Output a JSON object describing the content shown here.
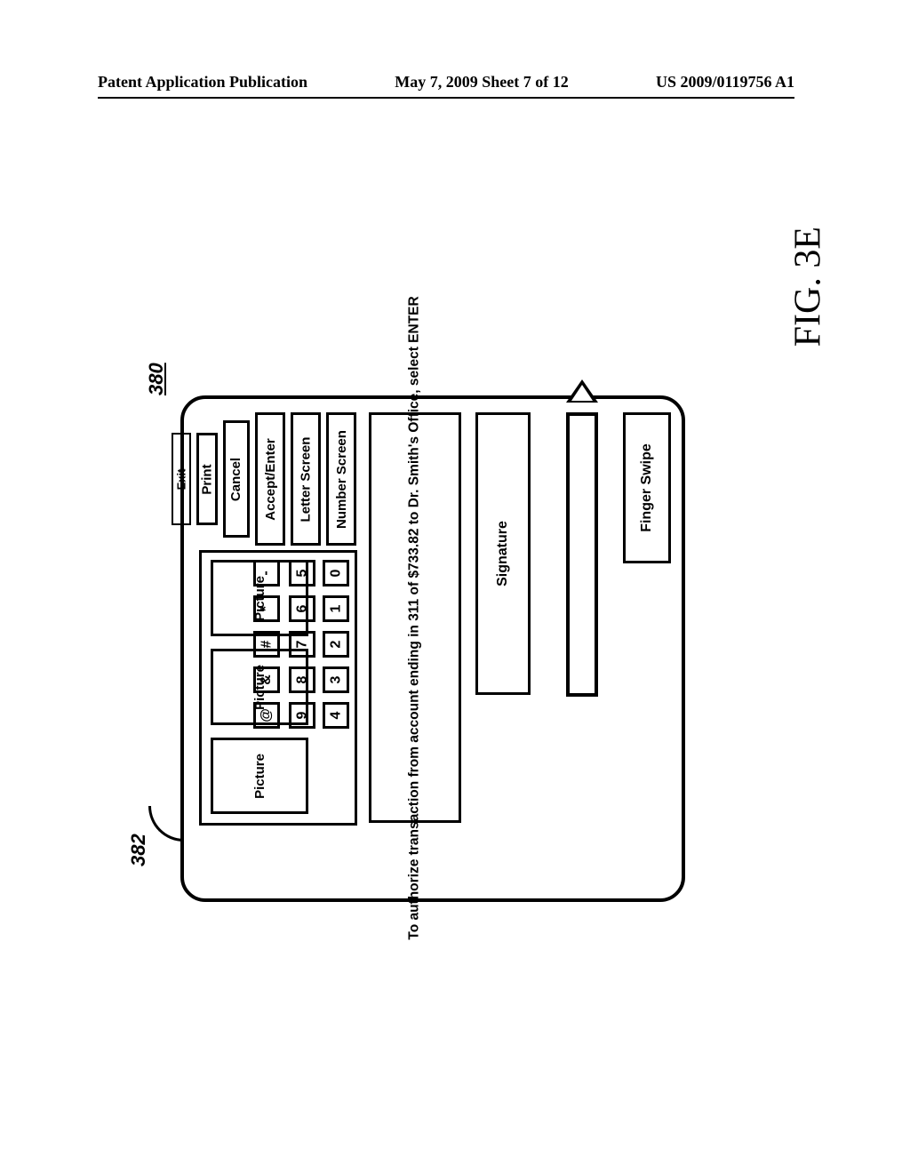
{
  "header": {
    "left": "Patent Application Publication",
    "center": "May 7, 2009  Sheet 7 of 12",
    "right": "US 2009/0119756 A1"
  },
  "figure_label": "FIG. 3E",
  "ref_380": "380",
  "ref_382": "382",
  "signature_label": "Signature",
  "message": "To authorize transaction from account ending in 311 of $733.82 to Dr. Smith's Office, select ENTER",
  "keypad": {
    "col0": [
      "0",
      "1",
      "2",
      "3",
      "4"
    ],
    "col1": [
      "5",
      "6",
      "7",
      "8",
      "9"
    ],
    "col2": [
      "-",
      "*",
      "#",
      "&",
      "@"
    ],
    "picture": "Picture"
  },
  "side_buttons": [
    "Number Screen",
    "Letter Screen",
    "Accept/Enter",
    "Cancel",
    "Print",
    "Exit"
  ],
  "finger_swipe": "Finger Swipe"
}
